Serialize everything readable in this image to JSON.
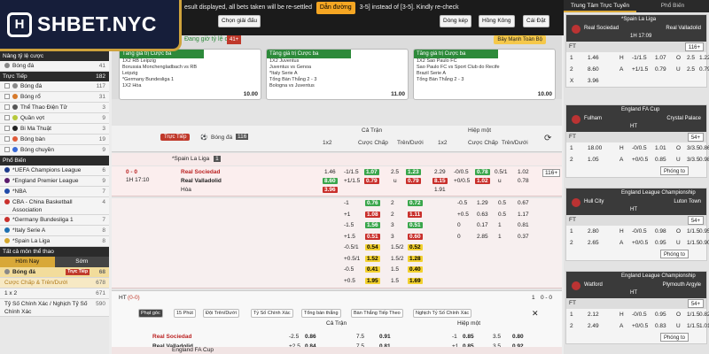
{
  "logo": {
    "text": "SHBET.NYC",
    "mark": "H"
  },
  "topbar": {
    "notice": "esult displayed, all bets taken will be re-settled",
    "notice_tail": "3-5] instead of [3-5]. Kindly re-check",
    "direction_button": "Dẫn đường",
    "choose_league": "Chọn giải đấu",
    "odds_type": "Dòng kép",
    "odds_format": "Hồng Kông",
    "sort": "Cái Đặt"
  },
  "left": {
    "sec1": {
      "label": "Nâng tỷ lệ cược",
      "items": [
        {
          "label": "Bóng đá",
          "count": "41"
        }
      ]
    },
    "sec2": {
      "label": "Trực Tiếp",
      "count": "182",
      "items": [
        {
          "label": "Bóng đá",
          "count": "117"
        },
        {
          "label": "Bóng rổ",
          "count": "31"
        },
        {
          "label": "Thể Thao Điện Tử",
          "count": "3"
        },
        {
          "label": "Quần vợt",
          "count": "9"
        },
        {
          "label": "Bi Ma Thuật",
          "count": "3"
        },
        {
          "label": "Bóng bàn",
          "count": "19"
        },
        {
          "label": "Bóng chuyền",
          "count": "9"
        }
      ]
    },
    "sec3": {
      "label": "Phổ Biến",
      "items": [
        {
          "label": "*UEFA Champions League",
          "count": "6"
        },
        {
          "label": "*England Premier League",
          "count": "9"
        },
        {
          "label": "*NBA",
          "count": "7"
        },
        {
          "label": "CBA - China Basketball Association",
          "count": "4"
        },
        {
          "label": "*Germany Bundesliga 1",
          "count": "7"
        },
        {
          "label": "*Italy Serie A",
          "count": "8"
        },
        {
          "label": "*Spain La Liga",
          "count": "8"
        }
      ]
    },
    "sec4": {
      "label": "Tất cả môn thể thao"
    },
    "tabs": {
      "today": "Hôm Nay",
      "early": "Sớm"
    },
    "sport": {
      "label": "Bóng đá",
      "live_badge": "Trực Tiếp",
      "count": "68"
    },
    "market": {
      "label": "Cược Chấp & Trên/Dưới",
      "count": "678"
    },
    "m2": {
      "label": "1 x 2",
      "count": "671"
    },
    "m3": {
      "label": "Tỷ Số Chính Xác / Nghịch Tỷ Số Chính Xác",
      "count": "590"
    }
  },
  "promo": {
    "title": "Đang giờ tỷ lệ cược",
    "count": "41+",
    "button": "Bảy Mạnh Toàn Bộ",
    "cards": [
      {
        "label": "Tăng giá trị Cược ba",
        "lines": [
          "1X2 RB Leipzig",
          "Borussia Monchengladbach vs RB",
          "Leipzig",
          "*Germany Bundesliga 1",
          "1X2 Hòa"
        ],
        "value": "10.00"
      },
      {
        "label": "Tăng giá trị Cược ba",
        "lines": [
          "1X2 Juventus",
          "Juventus vs Genoa",
          "*Italy Serie A",
          "Tổng Bàn Thắng 2 - 3",
          "Bologna vs Juventus"
        ],
        "value": "11.00"
      },
      {
        "label": "Tăng giá trị Cược ba",
        "lines": [
          "1X2 Sao Paulo FC",
          "Sao Paulo FC vs Sport Club do Recife",
          "Brazil Serie A",
          "Tổng Bàn Thắng 2 - 3"
        ],
        "value": "10.00"
      }
    ]
  },
  "center": {
    "live": "Trực Tiếp",
    "sport": "Bóng đá",
    "count": "116",
    "full": "Cả Trận",
    "half": "Hiệp một",
    "c1x2": "1x2",
    "hdp": "Cược Chấp",
    "ou": "Trên/Dưới",
    "league": "*Spain La Liga",
    "league_count": "1",
    "match": {
      "score": "0 - 0",
      "time": "1H 17:10",
      "home": "Real Sociedad",
      "away": "Real Valladolid",
      "draw": "Hòa",
      "more": "116+"
    },
    "main_lines": [
      {
        "x": "1.46",
        "h1": "-1/1.5",
        "o1": "1.07",
        "ou": "2.5",
        "o2": "1.23",
        "hx": "2.29",
        "hh": "-0/0.5",
        "ho": "0.78",
        "hou": "0.5/1",
        "hv": "1.02"
      },
      {
        "x": "8.60",
        "h1": "+1/1.5",
        "o1": "0.79",
        "ou": "u",
        "o2": "0.79",
        "hx": "8.15",
        "hh": "+0/0.5",
        "ho": "1.02",
        "hou": "u",
        "hv": "0.78"
      },
      {
        "x": "3.96",
        "h1": "",
        "o1": "",
        "ou": "",
        "o2": "",
        "hx": "1.91",
        "hh": "",
        "ho": "",
        "hou": "",
        "hv": ""
      }
    ],
    "more_lines": [
      {
        "h": "-1",
        "a": "0.76",
        "ou": "2",
        "b": "0.72",
        "hh": "-0.5",
        "c": "1.29",
        "hou": "0.5",
        "d": "0.67"
      },
      {
        "h": "+1",
        "a": "1.08",
        "ou": "2",
        "b": "1.11",
        "hh": "+0.5",
        "c": "0.63",
        "hou": "0.5",
        "d": "1.17"
      },
      {
        "h": "-1.5",
        "a": "1.56",
        "ou": "3",
        "b": "0.51",
        "hh": "0",
        "c": "0.17",
        "hou": "1",
        "d": "0.81"
      },
      {
        "h": "+1.5",
        "a": "0.51",
        "ou": "3",
        "b": "0.60",
        "hh": "0",
        "c": "2.85",
        "hou": "1",
        "d": "0.37"
      },
      {
        "h": "-0.5/1",
        "a": "0.54",
        "ou": "1.5/2",
        "b": "0.52",
        "hh": "",
        "c": "",
        "hou": "",
        "d": ""
      },
      {
        "h": "+0.5/1",
        "a": "1.52",
        "ou": "1.5/2",
        "b": "1.28",
        "hh": "",
        "c": "",
        "hou": "",
        "d": ""
      },
      {
        "h": "-0.5",
        "a": "0.41",
        "ou": "1.5",
        "b": "0.40",
        "hh": "",
        "c": "",
        "hou": "",
        "d": ""
      },
      {
        "h": "+0.5",
        "a": "1.95",
        "ou": "1.5",
        "b": "1.69",
        "hh": "",
        "c": "",
        "hou": "",
        "d": ""
      }
    ],
    "ht": {
      "label": "HT",
      "score": "(0-0)",
      "chips": [
        "Phạt góc",
        "15 Phút",
        "Đội Trên/Dưới",
        "Tỷ Số Chính Xác",
        "Tổng bàn thắng",
        "Bàn Thắng Tiếp Theo",
        "Nghịch Tỷ Số Chính Xác"
      ],
      "home": "Real Sociedad",
      "away": "Real Valladolid",
      "draw": "Hòa",
      "rows": [
        {
          "h": "-2.5",
          "a": "0.86",
          "ou": "7.5",
          "b": "0.91",
          "hh": "-1",
          "c": "0.85",
          "hou": "3.5",
          "d": "0.80"
        },
        {
          "h": "+2.5",
          "a": "0.84",
          "ou": "7.5",
          "b": "0.81",
          "hh": "+1",
          "c": "0.85",
          "hou": "3.5",
          "d": "0.92"
        }
      ],
      "up": "1",
      "ft_score": "0 - 0"
    },
    "league2": "England FA Cup"
  },
  "right": {
    "tabs": [
      "Trung Tâm Trực Tuyến",
      "Phổ Biến"
    ],
    "cards": [
      {
        "league": "*Spain La Liga",
        "home": "Real Sociedad",
        "away": "Real Valladolid",
        "time": "1H 17:09",
        "ft": "FT",
        "more": "116+",
        "rows": [
          [
            "1",
            "1.46",
            "H",
            "-1/1.5",
            "1.07",
            "O",
            "2.5",
            "1.22"
          ],
          [
            "2",
            "8.60",
            "A",
            "+1/1.5",
            "0.79",
            "U",
            "2.5",
            "0.79"
          ],
          [
            "X",
            "3.96",
            "",
            "",
            "",
            "",
            "",
            ""
          ]
        ]
      },
      {
        "league": "England FA Cup",
        "home": "Fulham",
        "away": "Crystal Palace",
        "time": "HT",
        "ft": "FT",
        "more": "54+",
        "rows": [
          [
            "1",
            "18.00",
            "H",
            "-0/0.5",
            "1.01",
            "O",
            "3/3.5",
            "0.86"
          ],
          [
            "2",
            "1.05",
            "A",
            "+0/0.5",
            "0.85",
            "U",
            "3/3.5",
            "0.98"
          ]
        ],
        "btn": "Phóng to"
      },
      {
        "league": "England League Championship",
        "home": "Hull City",
        "away": "Luton Town",
        "time": "HT",
        "ft": "FT",
        "more": "54+",
        "rows": [
          [
            "1",
            "2.80",
            "H",
            "-0/0.5",
            "0.98",
            "O",
            "1/1.5",
            "0.95"
          ],
          [
            "2",
            "2.65",
            "A",
            "+0/0.5",
            "0.95",
            "U",
            "1/1.5",
            "0.90"
          ]
        ],
        "btn": "Phóng to"
      },
      {
        "league": "England League Championship",
        "home": "Watford",
        "away": "Plymouth Argyle",
        "time": "HT",
        "ft": "FT",
        "more": "54+",
        "rows": [
          [
            "1",
            "2.12",
            "H",
            "-0/0.5",
            "0.95",
            "O",
            "1/1.5",
            "0.82"
          ],
          [
            "2",
            "2.49",
            "A",
            "+0/0.5",
            "0.83",
            "U",
            "1/1.5",
            "1.01"
          ]
        ],
        "btn": "Phóng to"
      }
    ]
  }
}
